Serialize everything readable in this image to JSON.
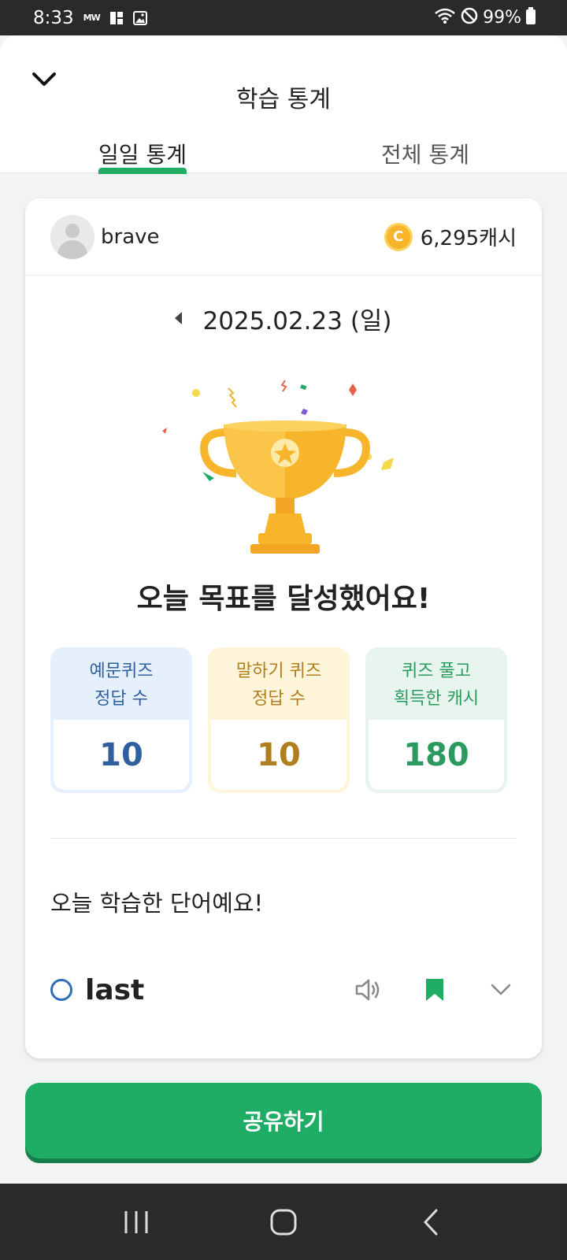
{
  "status_bar": {
    "time": "8:33",
    "mini_label": "MW",
    "battery": "99%",
    "icons": [
      "notification-icon",
      "image-icon",
      "wifi-icon",
      "do-not-disturb-icon",
      "battery-icon"
    ]
  },
  "header": {
    "title": "학습 통계",
    "tabs": [
      {
        "label": "일일 통계",
        "active": true
      },
      {
        "label": "전체 통계",
        "active": false
      }
    ],
    "accent_color": "#1fac65"
  },
  "profile": {
    "username": "brave",
    "cash": "6,295캐시"
  },
  "date": {
    "text": "2025.02.23 (일)"
  },
  "goal": {
    "message": "오늘 목표를 달성했어요!"
  },
  "stats": [
    {
      "label": "예문퀴즈\n정답 수",
      "value": "10",
      "color": "#2f5f9e"
    },
    {
      "label": "말하기 퀴즈\n정답 수",
      "value": "10",
      "color": "#b07e1c"
    },
    {
      "label": "퀴즈 풀고\n획득한 캐시",
      "value": "180",
      "color": "#2a9a5f"
    }
  ],
  "words_section": {
    "title": "오늘 학습한 단어예요!",
    "items": [
      {
        "word": "last",
        "bookmarked": true
      }
    ]
  },
  "share_button": {
    "label": "공유하기"
  }
}
